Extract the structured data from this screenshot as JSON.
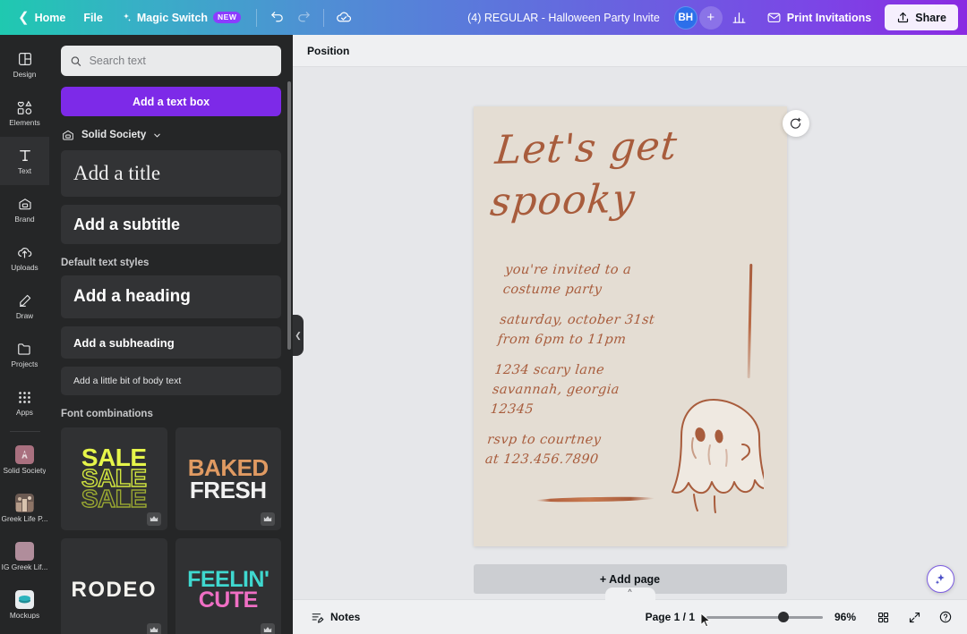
{
  "topbar": {
    "home_label": "Home",
    "file_label": "File",
    "magic_switch_label": "Magic Switch",
    "magic_switch_badge": "NEW",
    "undo_icon": "undo-icon",
    "redo_icon": "redo-icon",
    "cloud_icon": "cloud-saved-icon",
    "doc_title": "(4) REGULAR - Halloween Party Invite",
    "avatar_initials": "BH",
    "add_collaborator": "+",
    "insights_icon": "insights-icon",
    "print_label": "Print Invitations",
    "share_label": "Share"
  },
  "rail": {
    "items": [
      {
        "label": "Design",
        "icon": "design-icon"
      },
      {
        "label": "Elements",
        "icon": "elements-icon"
      },
      {
        "label": "Text",
        "icon": "text-icon"
      },
      {
        "label": "Brand",
        "icon": "brand-icon"
      },
      {
        "label": "Uploads",
        "icon": "uploads-icon"
      },
      {
        "label": "Draw",
        "icon": "draw-icon"
      },
      {
        "label": "Projects",
        "icon": "projects-icon"
      },
      {
        "label": "Apps",
        "icon": "apps-icon"
      }
    ],
    "brand_items": [
      {
        "label": "Solid Society",
        "icon": "brandkit-thumb"
      },
      {
        "label": "Greek Life P...",
        "icon": "brandkit-thumb"
      },
      {
        "label": "IG Greek Lif...",
        "icon": "brandkit-thumb"
      },
      {
        "label": "Mockups",
        "icon": "mockups-thumb"
      }
    ]
  },
  "panel": {
    "search_placeholder": "Search text",
    "search_value": "",
    "add_text_box": "Add a text box",
    "brand_kit_name": "Solid Society",
    "styles": [
      {
        "label": "Add a title"
      },
      {
        "label": "Add a subtitle"
      }
    ],
    "default_styles_label": "Default text styles",
    "default_styles": [
      {
        "label": "Add a heading"
      },
      {
        "label": "Add a subheading"
      },
      {
        "label": "Add a little bit of body text"
      }
    ],
    "font_combinations_label": "Font combinations",
    "font_combinations": [
      {
        "name": "sale-combo",
        "lines": [
          "SALE",
          "SALE",
          "SALE"
        ],
        "pro": true
      },
      {
        "name": "baked-fresh-combo",
        "lines": [
          "BAKED",
          "FRESH"
        ],
        "pro": true
      },
      {
        "name": "rodeo-combo",
        "lines": [
          "RODEO"
        ],
        "pro": true
      },
      {
        "name": "feelin-cute-combo",
        "lines": [
          "FEELIN'",
          "CUTE"
        ],
        "pro": true
      }
    ]
  },
  "editor": {
    "position_label": "Position",
    "canvas_tools": [
      "lock-icon",
      "duplicate-icon",
      "add-page-icon"
    ],
    "add_page_label": "+ Add page"
  },
  "design": {
    "headline_line1": "Let's get",
    "headline_line2": "spooky",
    "body": [
      "you're invited to a\ncostume party",
      "saturday, october 31st\nfrom 6pm to 11pm",
      "1234 scary lane\nsavannah, georgia\n12345",
      "rsvp to courtney\nat 123.456.7890"
    ],
    "ink_color": "#a85c3c",
    "paper_color": "#e4ddd3"
  },
  "bottombar": {
    "notes_label": "Notes",
    "page_indicator": "Page 1 / 1",
    "zoom_value": "96%",
    "grid_icon": "grid-view-icon",
    "fullscreen_icon": "fullscreen-icon",
    "help_icon": "help-icon"
  }
}
